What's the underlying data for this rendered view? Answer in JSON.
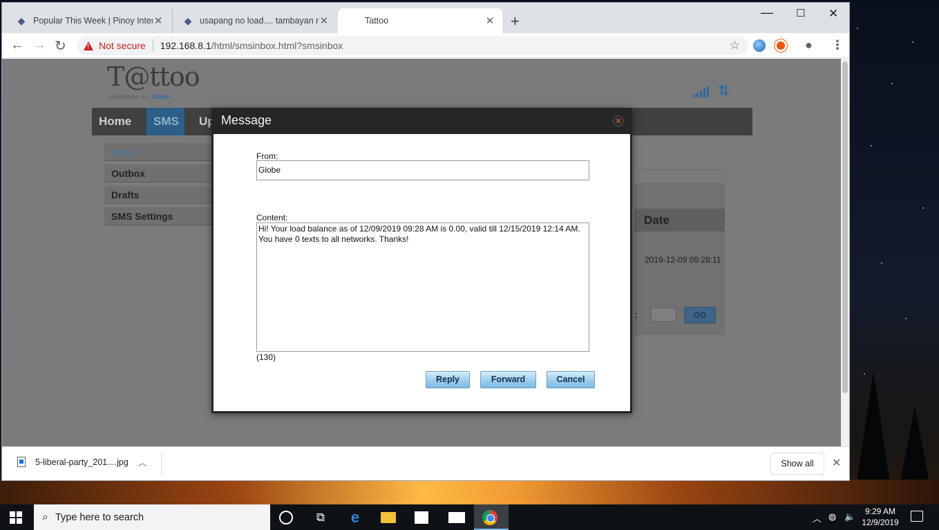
{
  "browser": {
    "tabs": [
      {
        "title": "Popular This Week | Pinoy Interne",
        "active": false
      },
      {
        "title": "usapang no load.... tambayan ng",
        "active": false
      },
      {
        "title": "Tattoo",
        "active": true
      }
    ],
    "new_tab": "+",
    "window_controls": {
      "minimize": "—",
      "maximize": "☐",
      "close": "✕"
    },
    "not_secure": "Not secure",
    "url_host": "192.168.8.1",
    "url_path": "/html/smsinbox.html?smsinbox"
  },
  "site": {
    "logo": "T@ttoo",
    "powered_by": "POWERED BY",
    "powered_brand": "Globe",
    "nav": [
      "Home",
      "SMS",
      "Up"
    ],
    "side_menu": [
      "Inbox",
      "Outbox",
      "Drafts",
      "SMS Settings"
    ],
    "table": {
      "date_header": "Date",
      "date_value": "2019-12-09 09:28:11"
    },
    "pager_colon": ":",
    "go_button": "GO"
  },
  "dialog": {
    "title": "Message",
    "from_label": "From:",
    "from_value": "Globe",
    "content_label": "Content:",
    "content_value": "Hi! Your load balance as of 12/09/2019 09:28 AM is 0.00, valid till 12/15/2019 12:14 AM. You have 0 texts to all networks. Thanks!",
    "char_count": "(130)",
    "buttons": {
      "reply": "Reply",
      "forward": "Forward",
      "cancel": "Cancel"
    }
  },
  "downloads": {
    "file_name": "5-liberal-party_201....jpg",
    "show_all": "Show all"
  },
  "taskbar": {
    "search_placeholder": "Type here to search",
    "time": "9:29 AM",
    "date": "12/9/2019"
  },
  "colors": {
    "modal_button_top": "#d6ecfa",
    "modal_button_bottom": "#7fb9e2",
    "not_secure_red": "#c5221f",
    "nav_active": "#2d5e87"
  }
}
